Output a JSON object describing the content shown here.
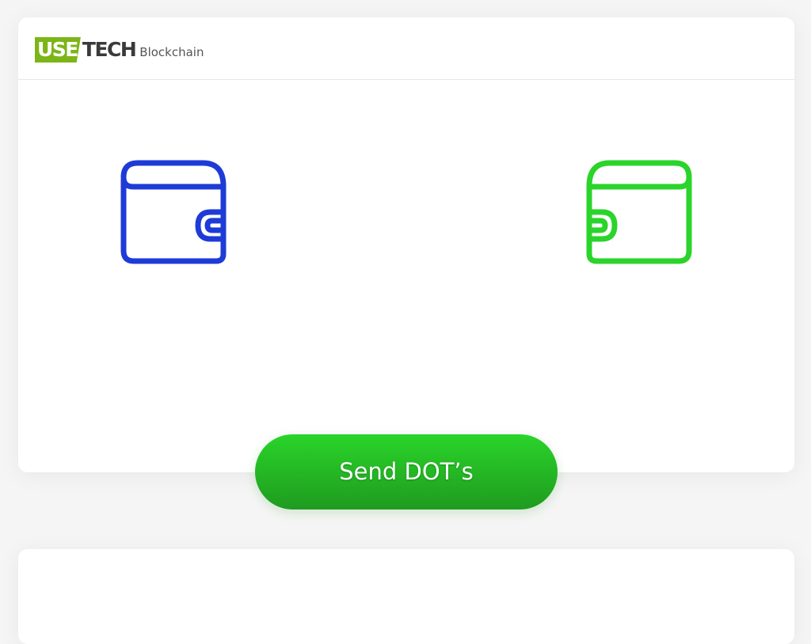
{
  "brand": {
    "logo_use": "USE",
    "logo_tech": "TECH",
    "logo_sub": "Blockchain"
  },
  "wallets": {
    "sender": {
      "icon": "wallet-icon",
      "color": "#1e3bd8"
    },
    "receiver": {
      "icon": "wallet-icon",
      "color": "#2ad42a"
    }
  },
  "actions": {
    "send_label": "Send DOT’s"
  },
  "colors": {
    "brand_green": "#7cb516",
    "button_green_top": "#2ad42a",
    "button_green_bottom": "#1f9b1f",
    "wallet_blue": "#1e3bd8",
    "wallet_green": "#2ad42a"
  }
}
